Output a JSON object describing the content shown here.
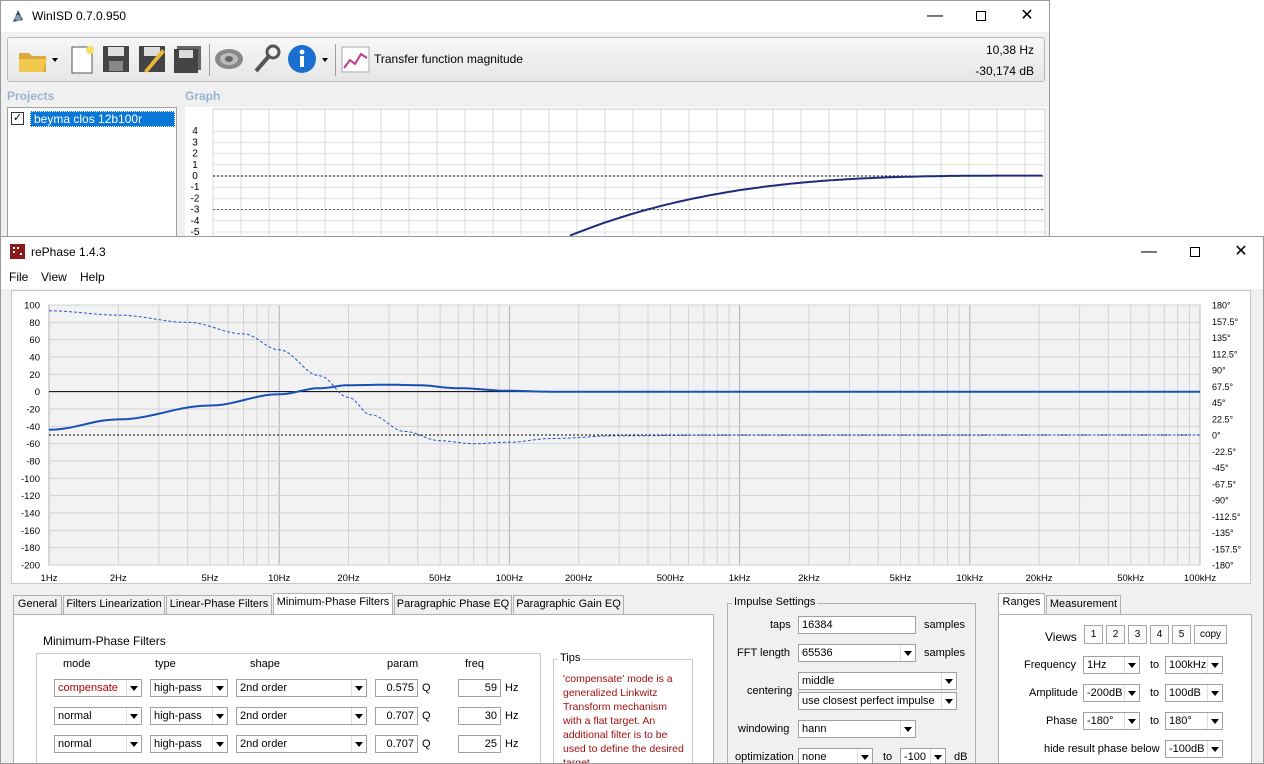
{
  "winisd": {
    "title": "WinISD 0.7.0.950",
    "toolbar": {
      "graph_name": "Transfer function magnitude",
      "freq_readout": "10,38 Hz",
      "db_readout": "-30,174 dB"
    },
    "projects_label": "Projects",
    "graph_label": "Graph",
    "project_item": "beyma clos 12b100r",
    "y_ticks": [
      "4",
      "3",
      "2",
      "1",
      "0",
      "-1",
      "-2",
      "-3",
      "-4",
      "-5"
    ]
  },
  "rephase": {
    "title": "rePhase 1.4.3",
    "menu": [
      "File",
      "View",
      "Help"
    ],
    "plot": {
      "left_ticks": [
        "100",
        "80",
        "60",
        "40",
        "20",
        "0",
        "-20",
        "-40",
        "-60",
        "-80",
        "-100",
        "-120",
        "-140",
        "-160",
        "-180",
        "-200"
      ],
      "right_ticks": [
        "180°",
        "157.5°",
        "135°",
        "112.5°",
        "90°",
        "67.5°",
        "45°",
        "22.5°",
        "0°",
        "-22.5°",
        "-45°",
        "-67.5°",
        "-90°",
        "-112.5°",
        "-135°",
        "-157.5°",
        "-180°"
      ],
      "x_labels": [
        "1Hz",
        "2Hz",
        "5Hz",
        "10Hz",
        "20Hz",
        "50Hz",
        "100Hz",
        "200Hz",
        "500Hz",
        "1kHz",
        "2kHz",
        "5kHz",
        "10kHz",
        "20kHz",
        "50kHz",
        "100kHz"
      ]
    },
    "tabs": [
      "General",
      "Filters Linearization",
      "Linear-Phase Filters",
      "Minimum-Phase Filters",
      "Paragraphic Phase EQ",
      "Paragraphic Gain EQ"
    ],
    "active_tab": 3,
    "minphase": {
      "heading": "Minimum-Phase Filters",
      "headers": {
        "mode": "mode",
        "type": "type",
        "shape": "shape",
        "param": "param",
        "freq": "freq"
      },
      "rows": [
        {
          "mode": "compensate",
          "type": "high-pass",
          "shape": "2nd order",
          "param": "0.575",
          "param_unit": "Q",
          "freq": "59",
          "freq_unit": "Hz"
        },
        {
          "mode": "normal",
          "type": "high-pass",
          "shape": "2nd order",
          "param": "0.707",
          "param_unit": "Q",
          "freq": "30",
          "freq_unit": "Hz"
        },
        {
          "mode": "normal",
          "type": "high-pass",
          "shape": "2nd order",
          "param": "0.707",
          "param_unit": "Q",
          "freq": "25",
          "freq_unit": "Hz"
        }
      ],
      "tips_title": "Tips",
      "tips_text": "'compensate' mode is a generalized Linkwitz Transform mechanism with a flat target. An additional filter is to be used to define the desired target"
    },
    "impulse": {
      "title": "Impulse Settings",
      "taps_label": "taps",
      "taps_value": "16384",
      "taps_unit": "samples",
      "fft_label": "FFT length",
      "fft_value": "65536",
      "fft_unit": "samples",
      "centering_label": "centering",
      "centering_value": "middle",
      "centering_option": "use closest perfect impulse",
      "windowing_label": "windowing",
      "windowing_value": "hann",
      "optimization_label": "optimization",
      "optimization_value": "none",
      "optimization_to": "to",
      "optimization_db": "-100",
      "optimization_unit": "dB"
    },
    "ranges": {
      "tabs": [
        "Ranges",
        "Measurement"
      ],
      "views_label": "Views",
      "views": [
        "1",
        "2",
        "3",
        "4",
        "5",
        "copy"
      ],
      "frequency_label": "Frequency",
      "freq_from": "1Hz",
      "freq_to": "100kHz",
      "amplitude_label": "Amplitude",
      "amp_from": "-200dB",
      "amp_to": "100dB",
      "phase_label": "Phase",
      "phase_from": "-180°",
      "phase_to": "180°",
      "to_label": "to",
      "hide_label": "hide result phase below",
      "hide_value": "-100dB"
    }
  }
}
